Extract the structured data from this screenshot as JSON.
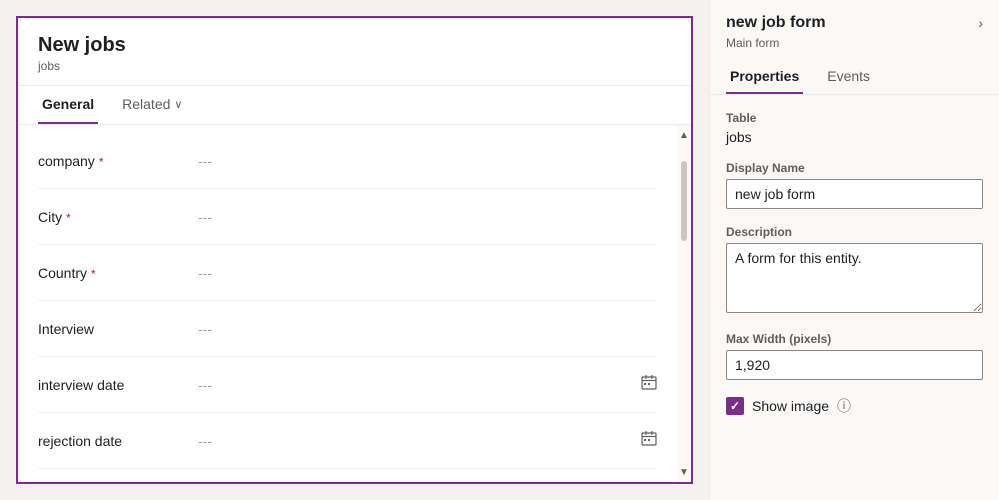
{
  "form": {
    "title": "New jobs",
    "subtitle": "jobs",
    "tabs": [
      {
        "label": "General",
        "active": true
      },
      {
        "label": "Related",
        "active": false
      }
    ],
    "fields": [
      {
        "label": "company",
        "required": true,
        "value": "---",
        "icon": null
      },
      {
        "label": "City",
        "required": true,
        "value": "---",
        "icon": null
      },
      {
        "label": "Country",
        "required": true,
        "value": "---",
        "icon": null
      },
      {
        "label": "Interview",
        "required": false,
        "value": "---",
        "icon": null
      },
      {
        "label": "interview date",
        "required": false,
        "value": "---",
        "icon": "calendar"
      },
      {
        "label": "rejection date",
        "required": false,
        "value": "---",
        "icon": "calendar"
      }
    ]
  },
  "properties_panel": {
    "title": "new job form",
    "subtitle": "Main form",
    "tabs": [
      {
        "label": "Properties",
        "active": true
      },
      {
        "label": "Events",
        "active": false
      }
    ],
    "table_label": "Table",
    "table_value": "jobs",
    "display_name_label": "Display Name",
    "display_name_value": "new job form",
    "description_label": "Description",
    "description_value": "A form for this entity.",
    "max_width_label": "Max Width (pixels)",
    "max_width_value": "1,920",
    "show_image_label": "Show image",
    "show_image_checked": true
  },
  "icons": {
    "calendar": "📅",
    "chevron_down": "∨",
    "chevron_right": "›",
    "check": "✓",
    "info": "ⓘ",
    "scroll_up": "▲",
    "scroll_down": "▼"
  }
}
